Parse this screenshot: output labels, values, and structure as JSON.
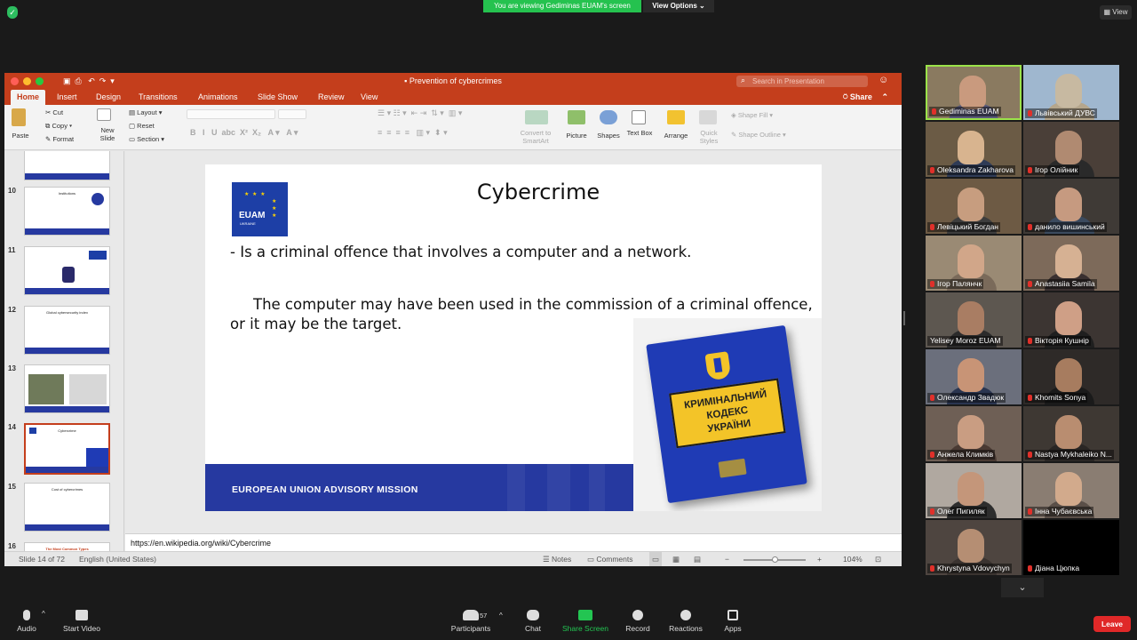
{
  "zoom": {
    "banner": "You are viewing Gediminas EUAM's screen",
    "view_options": "View Options ⌄",
    "view_button": "View",
    "toolbar": {
      "audio": "Audio",
      "start_video": "Start Video",
      "participants": "Participants",
      "participants_count": "57",
      "chat": "Chat",
      "share_screen": "Share Screen",
      "record": "Record",
      "reactions": "Reactions",
      "apps": "Apps",
      "leave": "Leave"
    },
    "gallery": [
      {
        "name": "Gediminas EUAM",
        "active": true,
        "face": "#c99a7e",
        "bg": "#8a7a60"
      },
      {
        "name": "Львівський ДУВС",
        "active": false,
        "face": "#c7b9a1",
        "bg": "#9fb7cf"
      },
      {
        "name": "Oleksandra Zakharova",
        "active": false,
        "face": "#d8b48f",
        "bg": "#6b5b45"
      },
      {
        "name": "Ігор Олійник",
        "active": false,
        "face": "#b08a71",
        "bg": "#4a3f38"
      },
      {
        "name": "Левіцький Богдан",
        "active": false,
        "face": "#c79d7f",
        "bg": "#6d5a44"
      },
      {
        "name": "данило вишинський",
        "active": false,
        "face": "#c69a80",
        "bg": "#3f3a36"
      },
      {
        "name": "Ігор Палянчк",
        "active": false,
        "face": "#d1a689",
        "bg": "#9a8a74"
      },
      {
        "name": "Anastasiia Samila",
        "active": false,
        "face": "#d6b193",
        "bg": "#7d6a5a"
      },
      {
        "name": "Yelisey Moroz EUAM",
        "active": false,
        "face": "#a97d63",
        "bg": "#5d5750"
      },
      {
        "name": "Вікторія Кушнір",
        "active": false,
        "face": "#cf9f86",
        "bg": "#3c3532"
      },
      {
        "name": "Олександр Звадюк",
        "active": false,
        "face": "#c89476",
        "bg": "#6b6f7c"
      },
      {
        "name": "Khomits Sonya",
        "active": false,
        "face": "#a77c5f",
        "bg": "#2e2a28"
      },
      {
        "name": "Анжела Климків",
        "active": false,
        "face": "#c99d82",
        "bg": "#6e5f55"
      },
      {
        "name": "Nastya Mykhaleiko N...",
        "active": false,
        "face": "#b98d70",
        "bg": "#3e3833"
      },
      {
        "name": "Олег Пигиляк",
        "active": false,
        "face": "#c4967a",
        "bg": "#b0a8a0"
      },
      {
        "name": "Інна Чубаєвська",
        "active": false,
        "face": "#d2aa8c",
        "bg": "#8a7d72"
      },
      {
        "name": "Khrystyna Vdovychyn",
        "active": false,
        "face": "#b58e73",
        "bg": "#4e4540"
      },
      {
        "name": "Діана Цюпка",
        "active": false,
        "face": "#000000",
        "bg": "#000000"
      }
    ]
  },
  "ppt": {
    "window_title": "Prevention of cybercrimes",
    "search_placeholder": "Search in Presentation",
    "tabs": [
      "Home",
      "Insert",
      "Design",
      "Transitions",
      "Animations",
      "Slide Show",
      "Review",
      "View"
    ],
    "share": "Share",
    "ribbon": {
      "paste": "Paste",
      "cut": "Cut",
      "copy": "Copy",
      "format": "Format",
      "new_slide": "New Slide",
      "layout": "Layout",
      "reset": "Reset",
      "section": "Section",
      "convert_smartart": "Convert to SmartArt",
      "picture": "Picture",
      "shapes": "Shapes",
      "text_box": "Text Box",
      "arrange": "Arrange",
      "quick_styles": "Quick Styles",
      "shape_fill": "Shape Fill",
      "shape_outline": "Shape Outline"
    },
    "thumbnails": [
      {
        "num": "10",
        "title": "Institutions"
      },
      {
        "num": "11",
        "title": ""
      },
      {
        "num": "12",
        "title": "Global cybersecurity index"
      },
      {
        "num": "13",
        "title": ""
      },
      {
        "num": "14",
        "title": "Cybercrime"
      },
      {
        "num": "15",
        "title": "Cost of cybercrimes"
      },
      {
        "num": "16",
        "title": "The Most Common Types"
      }
    ],
    "slide": {
      "logo_text": "EUAM",
      "logo_sub": "UKRAINE",
      "title": "Cybercrime",
      "bullet": "-  Is a criminal offence that involves a computer and a network.",
      "body": "The computer may have been used in the commission of a criminal offence, or it may be the target.",
      "footer": "EUROPEAN UNION ADVISORY MISSION",
      "book_line1": "КРИМІНАЛЬНИЙ",
      "book_line2": "КОДЕКС",
      "book_line3": "УКРАЇНИ"
    },
    "notes": "https://en.wikipedia.org/wiki/Cybercrime",
    "status": {
      "slide_of": "Slide 14 of 72",
      "language": "English (United States)",
      "notes": "Notes",
      "comments": "Comments",
      "zoom": "104%"
    }
  }
}
